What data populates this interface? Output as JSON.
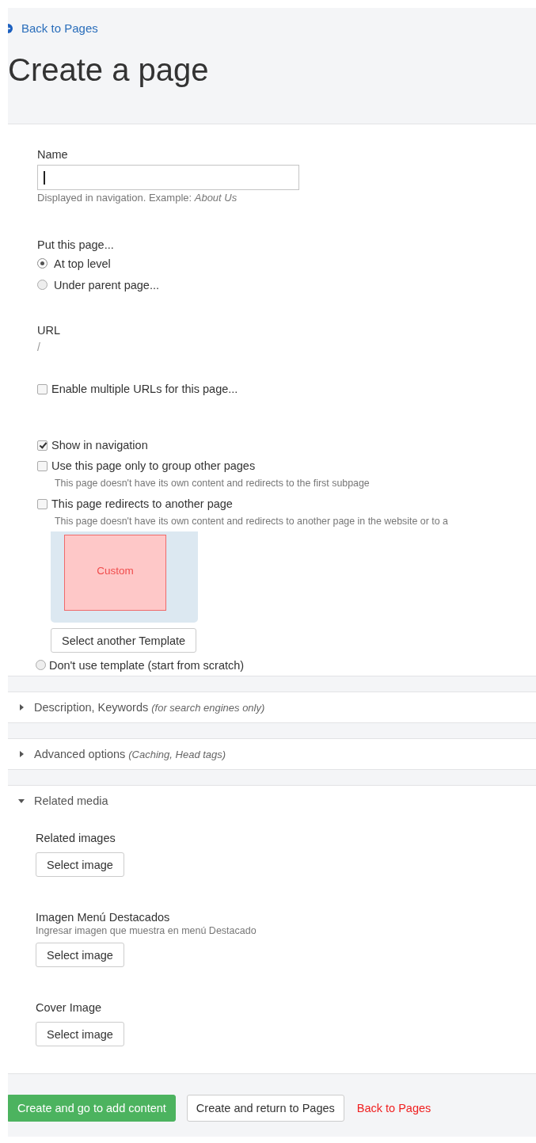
{
  "header": {
    "back_link": "Back to Pages",
    "title": "Create a page"
  },
  "name_field": {
    "label": "Name",
    "focused": true,
    "help": "Displayed in navigation. Example: *About Us*"
  },
  "placement": {
    "label": "Put this page...",
    "options": [
      {
        "label": "At top level",
        "selected": true
      },
      {
        "label": "Under parent page...",
        "selected": false
      }
    ]
  },
  "url": {
    "label": "URL",
    "value": "/"
  },
  "multiple_urls": {
    "label": "Enable multiple URLs for this page...",
    "checked": false
  },
  "nav_options": [
    {
      "label": "Show in navigation",
      "checked": true
    },
    {
      "label": "Use this page only to group other pages",
      "checked": false,
      "help": "This page doesn't have its own content and redirects to the first subpage"
    },
    {
      "label": "This page redirects to another page",
      "checked": false,
      "help": "This page doesn't have its own content and redirects to another page in the website or to a"
    }
  ],
  "template": {
    "tile": "Custom",
    "button": "Select another Template",
    "no_template": {
      "label": "Don't use template (start from scratch)",
      "selected": false
    }
  },
  "sections": [
    {
      "title": "Description, Keywords",
      "note": "(for search engines only)",
      "expanded": false
    },
    {
      "title": "Advanced options",
      "note": "(Caching, Head tags)",
      "expanded": false
    },
    {
      "title": "Related media",
      "expanded": true,
      "fields": [
        {
          "label": "Related images",
          "button": "Select image"
        },
        {
          "label": "Imagen Menú Destacados",
          "help": "Ingresar imagen que muestra en menú Destacado",
          "button": "Select image"
        },
        {
          "label": "Cover Image",
          "button": "Select image"
        }
      ]
    }
  ],
  "footer": {
    "buttons": [
      {
        "label": "Create and go to add content",
        "kind": "primary"
      },
      {
        "label": "Create and return to Pages",
        "kind": "default"
      },
      {
        "label": "Back to Pages",
        "kind": "link"
      }
    ]
  }
}
